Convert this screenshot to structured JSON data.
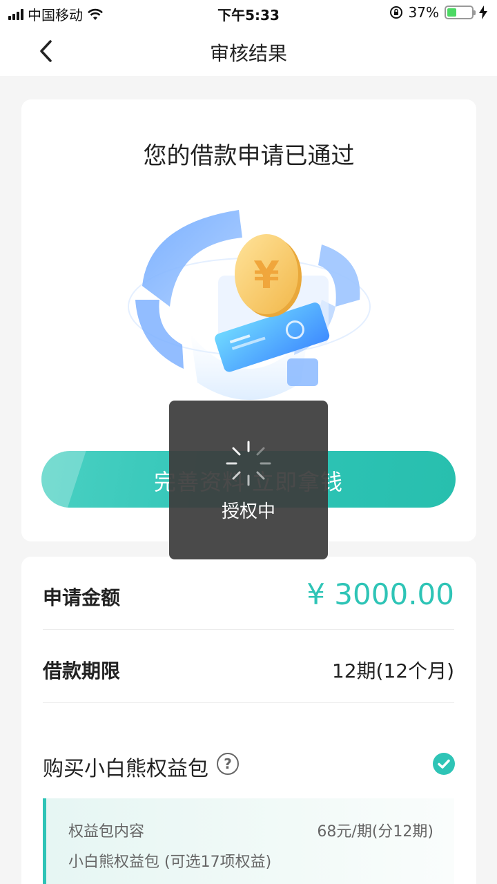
{
  "status_bar": {
    "carrier": "中国移动",
    "time": "下午5:33",
    "battery": "37%",
    "battery_level": 0.37
  },
  "nav": {
    "title": "审核结果",
    "back_icon": "chevron-left-icon"
  },
  "result": {
    "title": "您的借款申请已通过",
    "cta_label": "完善资料 立即拿钱"
  },
  "loan": {
    "amount_label": "申请金额",
    "amount_value": "¥ 3000.00",
    "term_label": "借款期限",
    "term_value": "12期(12个月)"
  },
  "benefit": {
    "label": "购买小白熊权益包",
    "help_icon": "question-circle-icon",
    "check_icon": "check-circle-icon",
    "checked": true,
    "package_title": "权益包内容",
    "package_price": "68元/期(分12期)",
    "package_name": "小白熊权益包 (可选17项权益)"
  },
  "toast": {
    "text": "授权中"
  },
  "colors": {
    "accent": "#2ec4b6",
    "toast_bg": "#3c3c3c",
    "battery": "#4cd964"
  }
}
